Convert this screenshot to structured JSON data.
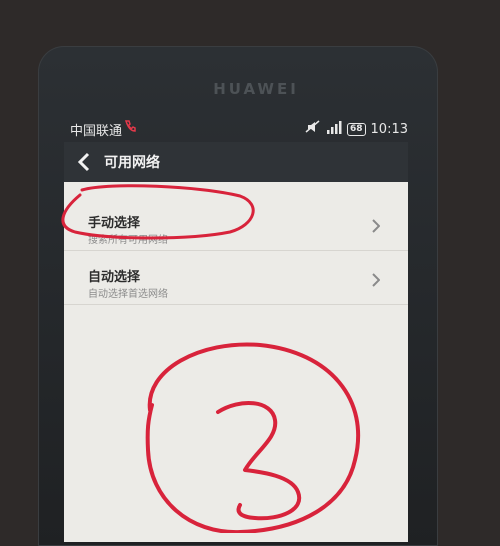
{
  "device": {
    "brand": "HUAWEI"
  },
  "status_bar": {
    "carrier": "中国联通",
    "battery": "68",
    "time": "10:13"
  },
  "header": {
    "title": "可用网络"
  },
  "network_options": [
    {
      "title": "手动选择",
      "subtitle": "搜索所有可用网络"
    },
    {
      "title": "自动选择",
      "subtitle": "自动选择首选网络"
    }
  ],
  "annotation": {
    "marker_color": "#d8233b"
  },
  "icons": [
    "call-forward-icon",
    "mute-icon",
    "signal-icon",
    "battery-icon",
    "back-chevron-icon",
    "chevron-right-icon"
  ]
}
